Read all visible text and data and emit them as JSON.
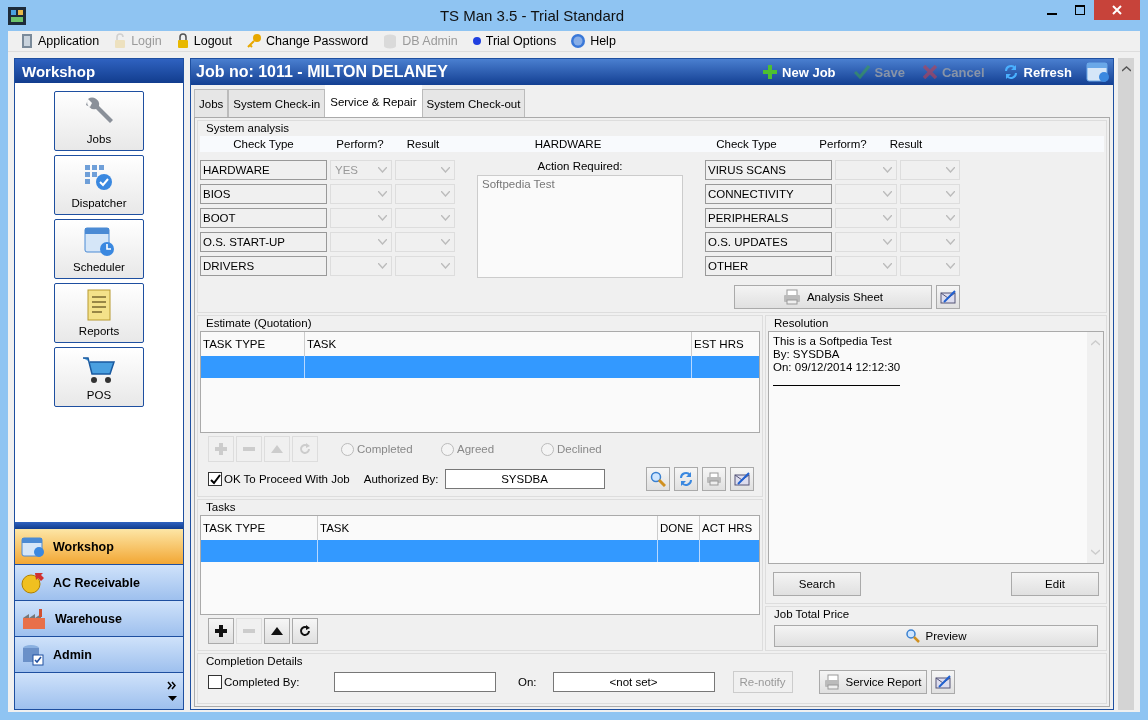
{
  "window": {
    "title": "TS Man 3.5 - Trial Standard"
  },
  "menu": [
    {
      "label": "Application",
      "disabled": false
    },
    {
      "label": "Login",
      "disabled": true
    },
    {
      "label": "Logout",
      "disabled": false
    },
    {
      "label": "Change Password",
      "disabled": false
    },
    {
      "label": "DB Admin",
      "disabled": true
    },
    {
      "label": "Trial Options",
      "disabled": false
    },
    {
      "label": "Help",
      "disabled": false
    }
  ],
  "sidebar": {
    "title": "Workshop",
    "tools": [
      "Jobs",
      "Dispatcher",
      "Scheduler",
      "Reports",
      "POS"
    ],
    "nav": [
      {
        "label": "Workshop",
        "selected": true
      },
      {
        "label": "AC Receivable",
        "selected": false
      },
      {
        "label": "Warehouse",
        "selected": false
      },
      {
        "label": "Admin",
        "selected": false
      }
    ]
  },
  "job": {
    "title": "Job no: 1011 - MILTON DELANEY",
    "actions": [
      {
        "label": "New Job",
        "disabled": false
      },
      {
        "label": "Save",
        "disabled": true
      },
      {
        "label": "Cancel",
        "disabled": true
      },
      {
        "label": "Refresh",
        "disabled": false
      }
    ]
  },
  "tabs": [
    {
      "label": "Jobs",
      "selected": false
    },
    {
      "label": "System Check-in",
      "selected": false
    },
    {
      "label": "Service & Repair",
      "selected": true
    },
    {
      "label": "System Check-out",
      "selected": false
    }
  ],
  "analysis": {
    "title": "System analysis",
    "left_headers": [
      "Check Type",
      "Perform?",
      "Result"
    ],
    "center_header": "HARDWARE",
    "right_headers": [
      "Check Type",
      "Perform?",
      "Result"
    ],
    "left_checks": [
      {
        "label": "HARDWARE",
        "perform": "YES"
      },
      {
        "label": "BIOS"
      },
      {
        "label": "BOOT"
      },
      {
        "label": "O.S. START-UP"
      },
      {
        "label": "DRIVERS"
      }
    ],
    "action_label": "Action Required:",
    "action_text": "Softpedia Test",
    "right_checks": [
      {
        "label": "VIRUS SCANS"
      },
      {
        "label": "CONNECTIVITY"
      },
      {
        "label": "PERIPHERALS"
      },
      {
        "label": "O.S. UPDATES"
      },
      {
        "label": "OTHER"
      }
    ],
    "sheet_button": "Analysis Sheet"
  },
  "estimate": {
    "title": "Estimate (Quotation)",
    "columns": [
      "TASK TYPE",
      "TASK",
      "EST HRS"
    ],
    "rows": [
      {
        "selected": true
      }
    ],
    "tools": [
      {
        "disabled": true
      },
      {
        "disabled": true
      },
      {
        "disabled": true
      },
      {
        "disabled": true
      }
    ],
    "status_options": [
      {
        "label": "Completed",
        "selected": false
      },
      {
        "label": "Agreed",
        "selected": false
      },
      {
        "label": "Declined",
        "selected": false
      }
    ],
    "ok_to_proceed": {
      "label": "OK To Proceed With Job",
      "checked": true
    },
    "authorized_label": "Authorized By:",
    "authorized_by": "SYSDBA"
  },
  "tasks": {
    "title": "Tasks",
    "columns": [
      "TASK TYPE",
      "TASK",
      "DONE",
      "ACT HRS"
    ],
    "rows": [
      {
        "selected": true
      }
    ],
    "tools": [
      {
        "disabled": false
      },
      {
        "disabled": true
      },
      {
        "disabled": false
      },
      {
        "disabled": false
      }
    ]
  },
  "resolution": {
    "title": "Resolution",
    "lines": [
      "This is a Softpedia Test",
      "By: SYSDBA",
      "On: 09/12/2014 12:12:30"
    ],
    "search": "Search",
    "edit": "Edit"
  },
  "total": {
    "title": "Job Total Price",
    "preview": "Preview"
  },
  "completion": {
    "title": "Completion Details",
    "completed_by": {
      "label": "Completed By:",
      "checked": false
    },
    "on_label": "On:",
    "on_value": "<not set>",
    "renotify": {
      "label": "Re-notify",
      "disabled": true
    },
    "report_button": "Service Report"
  }
}
